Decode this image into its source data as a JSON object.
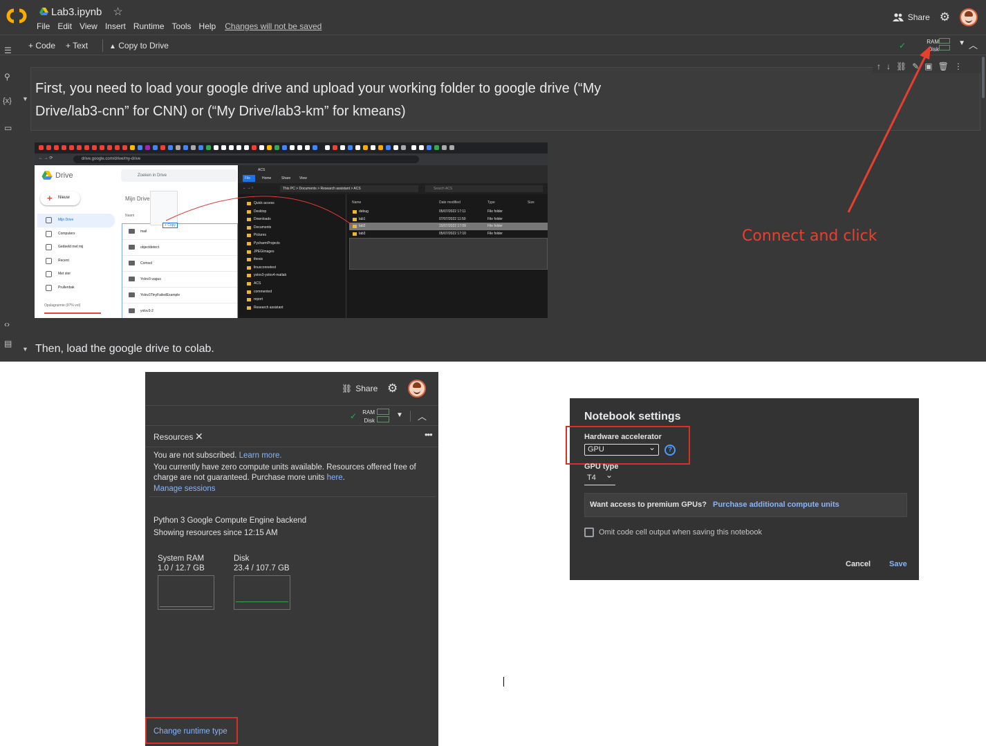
{
  "colab": {
    "notebook_title": "Lab3.ipynb",
    "menu": [
      "File",
      "Edit",
      "View",
      "Insert",
      "Runtime",
      "Tools",
      "Help"
    ],
    "unsaved_notice": "Changes will not be saved",
    "share_label": "Share",
    "toolbar": {
      "code_label": "+ Code",
      "text_label": "+ Text",
      "copy_to_drive_label": "Copy to Drive"
    },
    "resource_labels": {
      "ram": "RAM",
      "disk": "Disk"
    },
    "cell1_text": "First, you need to load your google drive and upload your working folder to google drive (“My Drive/lab3-cnn” for CNN) or (“My Drive/lab3-km” for kmeans)",
    "cell2_text": "Then, load the google drive to colab.",
    "annotation_text": "Connect and click",
    "annotation_color": "#e8402f",
    "icons": [
      "star-icon",
      "share-icon",
      "gear-icon",
      "toc-icon",
      "search-icon",
      "variables-icon",
      "folder-icon",
      "code-snippets-icon",
      "terminal-icon"
    ]
  },
  "embedded": {
    "url": "drive.google.com/drive/my-drive",
    "drive_title": "Drive",
    "search_placeholder": "Zoeken in Drive",
    "new_button": "Nieuw",
    "nav": [
      "Mijn Drive",
      "Computers",
      "Gedeeld met mij",
      "Recent",
      "Met ster",
      "Prullenbak",
      "Opslagruimte (97% vol)"
    ],
    "page_heading": "Mijn Drive",
    "column_name": "Naam",
    "copy_label": "Copy",
    "files": [
      "mail",
      "objectdetect",
      "Comsol",
      "Yolov3-vagus",
      "Yolov3TinyFailedExample",
      "yolov3-2"
    ],
    "explorer_title": "ACS",
    "ribbon": [
      "File",
      "Home",
      "Share",
      "View"
    ],
    "path": "This PC  >  Documents  >  Research assistant  >  ACS",
    "search_label": "Search ACS",
    "tree": [
      "Quick access",
      "Desktop",
      "Downloads",
      "Documents",
      "Pictures",
      "PycharmProjects",
      "JPEGImages",
      "thesis",
      "linuxconnetest",
      "yolov3-yolov4-matlab",
      "ACS",
      "commented",
      "report",
      "Research assistant"
    ],
    "columns": [
      "Name",
      "Date modified",
      "Type",
      "Size"
    ],
    "rows": [
      {
        "name": "debug",
        "date": "05/07/2022 17:11",
        "type": "File folder"
      },
      {
        "name": "lab1",
        "date": "07/07/2022 11:50",
        "type": "File folder"
      },
      {
        "name": "lab2",
        "date": "15/07/2022 17:09",
        "type": "File folder"
      },
      {
        "name": "lab3",
        "date": "05/07/2022 17:10",
        "type": "File folder"
      }
    ]
  },
  "resources": {
    "share_label": "Share",
    "ram_label": "RAM",
    "disk_label": "Disk",
    "tab_label": "Resources",
    "not_subscribed": "You are not subscribed.",
    "learn_more": "Learn more.",
    "compute_units_text": "You currently have zero compute units available. Resources offered free of charge are not guaranteed. Purchase more units",
    "here_link": "here",
    "manage_sessions": "Manage sessions",
    "backend": "Python 3 Google Compute Engine backend",
    "since": "Showing resources since 12:15 AM",
    "system_ram_label": "System RAM",
    "system_ram_value": "1.0 / 12.7 GB",
    "disk_meter_label": "Disk",
    "disk_meter_value": "23.4 / 107.7 GB",
    "change_runtime": "Change runtime type"
  },
  "notebook_settings": {
    "title": "Notebook settings",
    "hw_label": "Hardware accelerator",
    "hw_value": "GPU",
    "gpu_type_label": "GPU type",
    "gpu_type_value": "T4",
    "premium_question": "Want access to premium GPUs?",
    "premium_link": "Purchase additional compute units",
    "omit_label": "Omit code cell output when saving this notebook",
    "cancel": "Cancel",
    "save": "Save"
  }
}
